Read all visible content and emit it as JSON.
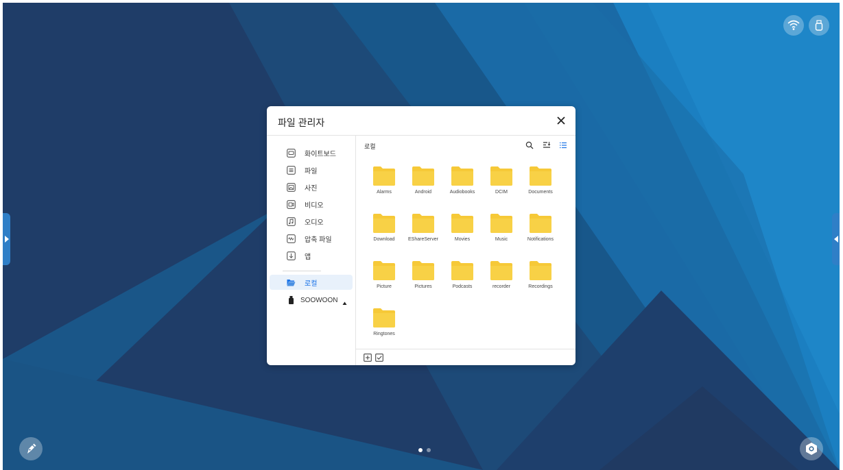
{
  "window": {
    "title": "파일 관리자",
    "close_icon": "close-icon"
  },
  "sidebar": {
    "items": [
      {
        "label": "화이트보드",
        "icon": "whiteboard-icon"
      },
      {
        "label": "파일",
        "icon": "document-icon"
      },
      {
        "label": "사진",
        "icon": "image-icon"
      },
      {
        "label": "비디오",
        "icon": "video-icon"
      },
      {
        "label": "오디오",
        "icon": "music-icon"
      },
      {
        "label": "압축 파일",
        "icon": "archive-icon"
      },
      {
        "label": "앱",
        "icon": "download-icon"
      }
    ],
    "local": {
      "label": "로컬",
      "icon": "folder-open-icon"
    },
    "usb": {
      "label": "SOOWOON",
      "icon": "usb-drive-icon",
      "eject_icon": "eject-icon"
    }
  },
  "main": {
    "breadcrumb": "로컬",
    "tools": [
      "search-icon",
      "sort-icon",
      "list-view-icon"
    ],
    "folders": [
      "Alarms",
      "Android",
      "Audiobooks",
      "DCIM",
      "Documents",
      "Download",
      "EShareServer",
      "Movies",
      "Music",
      "Notifications",
      "Picture",
      "Pictures",
      "Podcasts",
      "recorder",
      "Recordings",
      "Ringtones"
    ]
  },
  "footer": {
    "icons": [
      "new-folder-icon",
      "select-checkbox-icon"
    ]
  },
  "status_bar": {
    "icons": [
      "wifi-icon",
      "usb-icon"
    ]
  },
  "dock": {
    "left_icon": "pen-tool-icon",
    "right_icon": "settings-icon",
    "page_count": 2,
    "active_page": 1
  },
  "colors": {
    "accent": "#1a73e8",
    "folder": "#f6c938",
    "wallpaper_dark": "#1f3d68",
    "wallpaper_light": "#1b7fc1"
  }
}
